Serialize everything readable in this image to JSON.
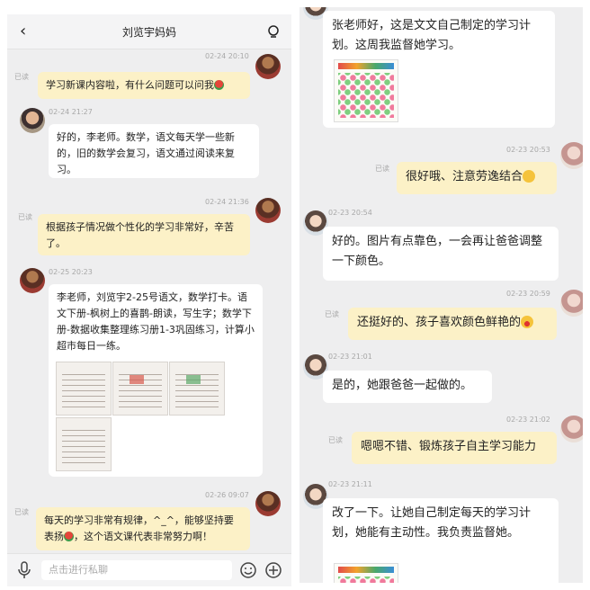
{
  "left": {
    "header": {
      "back": "‹",
      "title": "刘览宇妈妈"
    },
    "messages": [
      {
        "time": "02-24 20:10",
        "read": "已读",
        "text": "学习新课内容啦，有什么问题可以问我"
      },
      {
        "time": "02-24 21:27",
        "text": "好的，李老师。数学，语文每天学一些新的，旧的数学会复习，语文通过阅读来复习。"
      },
      {
        "time": "02-24 21:36",
        "read": "已读",
        "text": "根据孩子情况做个性化的学习非常好，辛苦了。"
      },
      {
        "time": "02-25 20:23",
        "text": "李老师，刘览宇2-25号语文，数学打卡。语文下册-枫树上的喜鹊-朗读，写生字；数学下册-数据收集整理练习册1-3巩固练习，计算小超市每日一练。"
      },
      {
        "time": "02-26 09:07",
        "read": "已读",
        "text_a": "每天的学习非常有规律，^_^，能够坚持要表扬",
        "text_b": "，这个语文课代表非常努力啊！"
      }
    ],
    "input_placeholder": "点击进行私聊"
  },
  "right": {
    "messages": [
      {
        "text": "张老师好，这是文文自己制定的学习计划。这周我监督她学习。"
      },
      {
        "time": "02-23 20:53",
        "read": "已读",
        "text": "很好哦、注意劳逸结合"
      },
      {
        "time": "02-23 20:54",
        "text": "好的。图片有点靠色，一会再让爸爸调整一下颜色。"
      },
      {
        "time": "02-23 20:59",
        "read": "已读",
        "text": "还挺好的、孩子喜欢颜色鲜艳的"
      },
      {
        "time": "02-23 21:01",
        "text": "是的，她跟爸爸一起做的。"
      },
      {
        "time": "02-23 21:02",
        "read": "已读",
        "text": "嗯嗯不错、锻炼孩子自主学习能力"
      },
      {
        "time": "02-23 21:11",
        "text": "改了一下。让她自己制定每天的学习计划，她能有主动性。我负责监督她。"
      }
    ]
  },
  "colors": {
    "bubble_yellow": "#fcf1c7",
    "bubble_white": "#ffffff",
    "chat_bg": "#eeeeef"
  },
  "icons": [
    "back-arrow-icon",
    "menu-icon",
    "microphone-icon",
    "smile-icon",
    "plus-icon",
    "rose-emoji-icon",
    "grin-emoji-icon",
    "surprised-emoji-icon"
  ]
}
